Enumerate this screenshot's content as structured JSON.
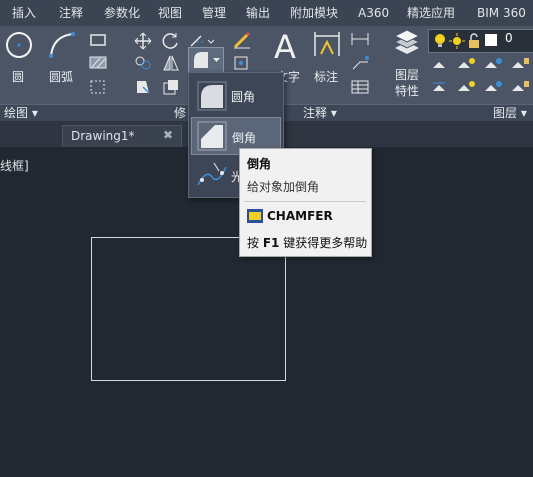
{
  "menu": [
    "插入",
    "注释",
    "参数化",
    "视图",
    "管理",
    "输出",
    "附加模块",
    "A360",
    "精选应用",
    "BIM 360"
  ],
  "ribbon": {
    "draw": {
      "circle_label": "圆",
      "arc_label": "圆弧",
      "panel_label": "绘图 ▾"
    },
    "modify": {
      "panel_label": "修"
    },
    "annotate": {
      "text_label": "文字",
      "dim_label": "标注",
      "panel_label": "注释 ▾"
    },
    "layers": {
      "props_label_1": "图层",
      "props_label_2": "特性",
      "panel_label": "图层 ▾",
      "layer_value": "0"
    }
  },
  "dropdown": {
    "items": [
      {
        "label": "圆角"
      },
      {
        "label": "倒角"
      },
      {
        "label": "光"
      }
    ]
  },
  "tooltip": {
    "title": "倒角",
    "description": "给对象加倒角",
    "command": "CHAMFER",
    "help_prefix": "按 ",
    "help_key": "F1",
    "help_suffix": " 键获得更多帮助"
  },
  "doc_tab": {
    "label": "Drawing1*",
    "close": "✖"
  },
  "viewport_label": "线框]",
  "colors": {
    "accent": "#3c8fd9",
    "canvas": "#212831",
    "ribbon": "#4b5566"
  }
}
